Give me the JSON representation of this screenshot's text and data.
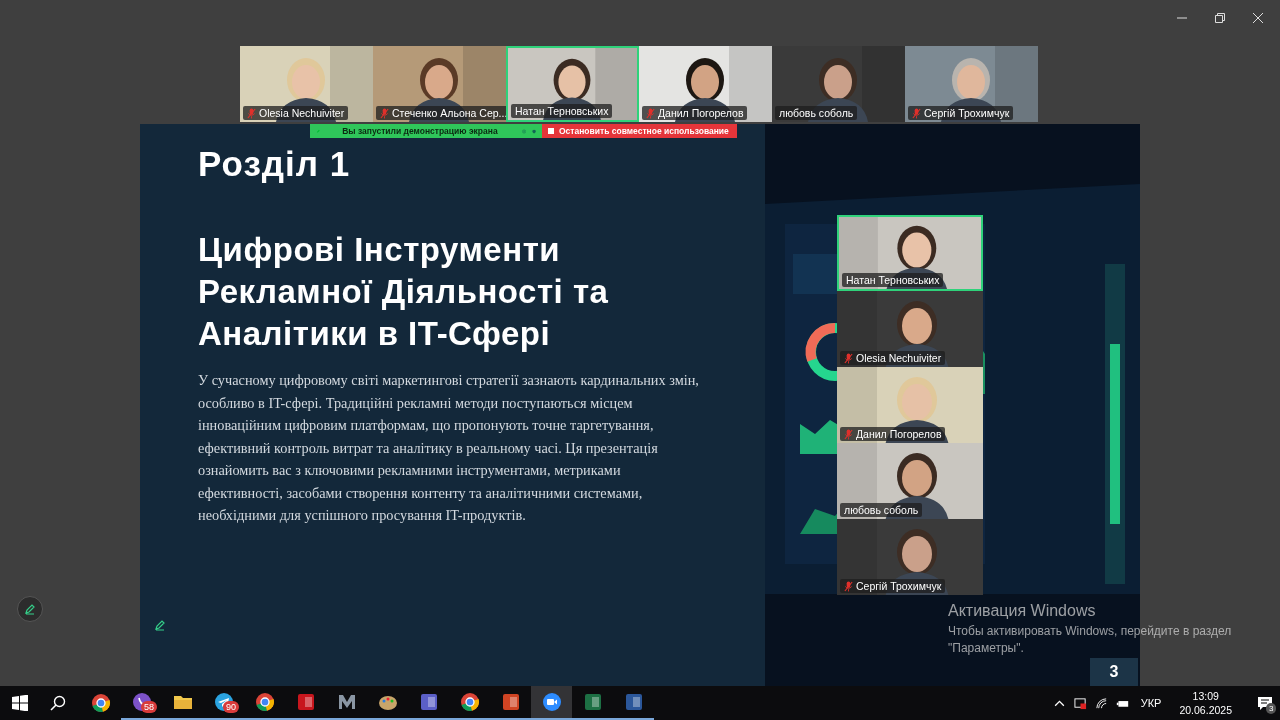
{
  "participants_strip": [
    {
      "name": "Olesia Nechuiviter",
      "muted": true,
      "selected": false
    },
    {
      "name": "Стеченко Альона Сер...",
      "muted": true,
      "selected": false
    },
    {
      "name": "Натан Терновських",
      "muted": false,
      "selected": true
    },
    {
      "name": "Данил Погорелов",
      "muted": true,
      "selected": false
    },
    {
      "name": "любовь соболь",
      "muted": false,
      "selected": false
    },
    {
      "name": "Сергій Трохимчук",
      "muted": true,
      "selected": false
    }
  ],
  "share_bar": {
    "status": "Вы запустили демонстрацию экрана",
    "stop": "Остановить совместное использование"
  },
  "slide": {
    "section": "Розділ 1",
    "title": "Цифрові Інструменти Рекламної Діяльності та Аналітики в IT-Сфері",
    "body": "У сучасному цифровому світі маркетингові стратегії зазнають кардинальних змін, особливо в IT-сфері. Традиційні рекламні методи поступаються місцем інноваційним цифровим платформам, що пропонують точне таргетування, ефективний контроль витрат та аналітику в реальному часі. Ця презентація ознайомить вас з ключовими рекламними інструментами, метриками ефективності, засобами створення контенту та аналітичними системами, необхідними для успішного просування IT-продуктів.",
    "page": "3"
  },
  "gallery": [
    {
      "name": "Натан Терновських",
      "muted": false,
      "selected": true
    },
    {
      "name": "Olesia Nechuiviter",
      "muted": true,
      "selected": false
    },
    {
      "name": "Данил Погорелов",
      "muted": true,
      "selected": false
    },
    {
      "name": "любовь соболь",
      "muted": false,
      "selected": false
    },
    {
      "name": "Сергій Трохимчук",
      "muted": true,
      "selected": false
    }
  ],
  "activation": {
    "title": "Активация Windows",
    "text": "Чтобы активировать Windows, перейдите в раздел \"Параметры\"."
  },
  "taskbar": {
    "apps": [
      {
        "kind": "chrome",
        "running": false,
        "selected": false
      },
      {
        "kind": "viber",
        "running": true,
        "selected": false,
        "badge": "58"
      },
      {
        "kind": "folder",
        "running": true,
        "selected": false
      },
      {
        "kind": "telegram",
        "running": true,
        "selected": false,
        "badge": "90"
      },
      {
        "kind": "chrome",
        "running": true,
        "selected": false
      },
      {
        "kind": "pdf",
        "running": true,
        "selected": false
      },
      {
        "kind": "metal",
        "running": true,
        "selected": false
      },
      {
        "kind": "paint",
        "running": true,
        "selected": false
      },
      {
        "kind": "teams",
        "running": true,
        "selected": false
      },
      {
        "kind": "chrome",
        "running": true,
        "selected": false
      },
      {
        "kind": "powerpoint",
        "running": true,
        "selected": false
      },
      {
        "kind": "zoom",
        "running": true,
        "selected": true
      },
      {
        "kind": "excel",
        "running": true,
        "selected": false
      },
      {
        "kind": "word",
        "running": true,
        "selected": false
      }
    ],
    "language": "УКР",
    "time": "13:09",
    "date": "20.06.2025",
    "notifications": "3"
  }
}
